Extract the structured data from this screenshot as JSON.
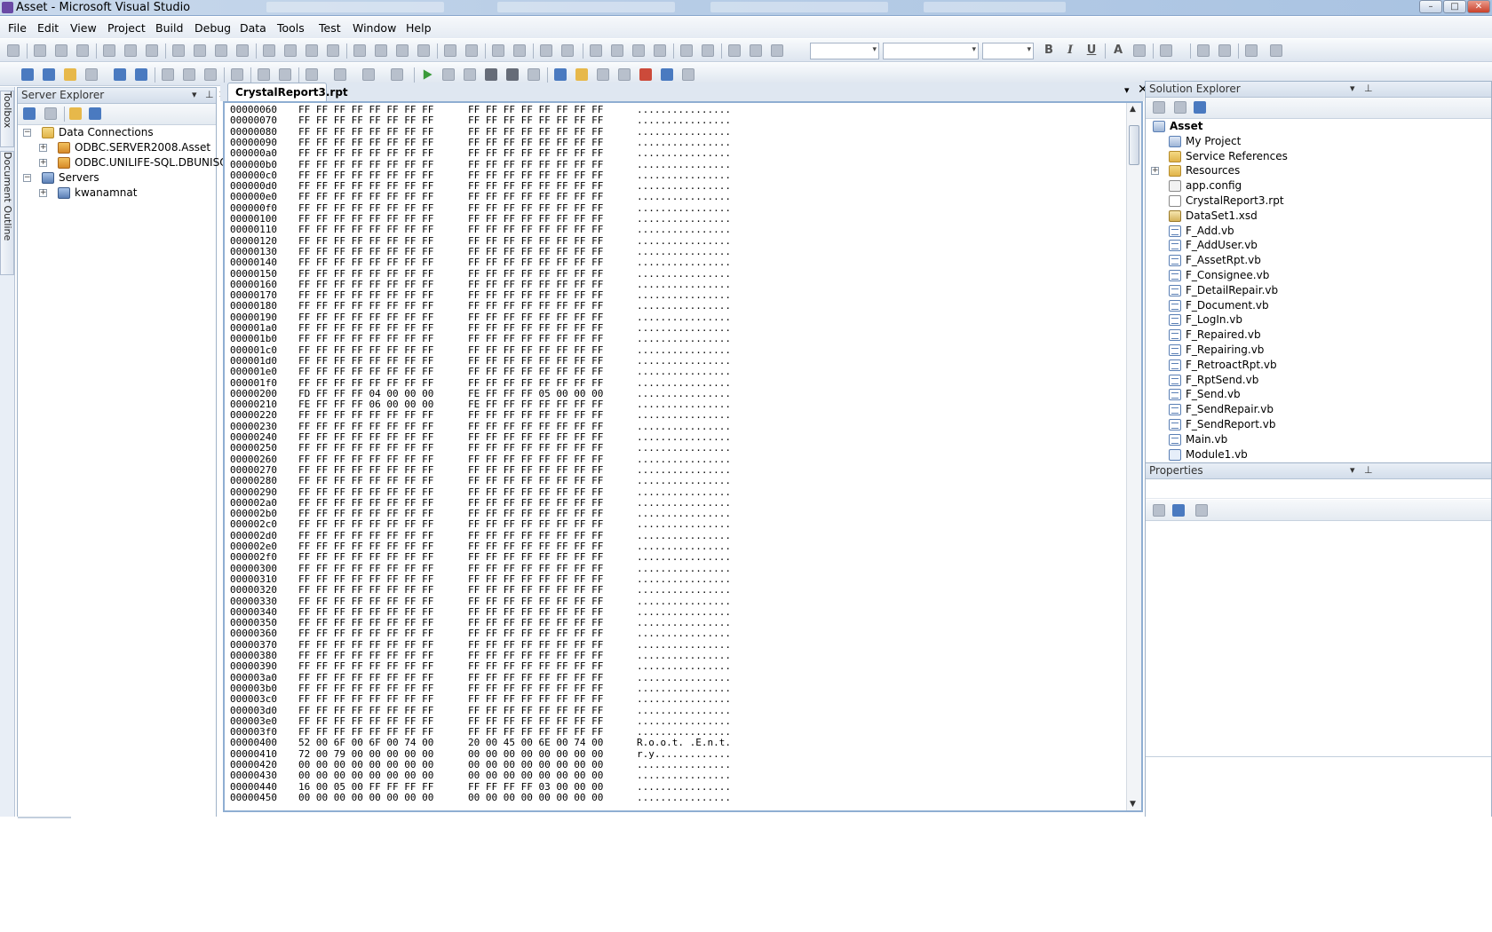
{
  "window": {
    "title": "Asset - Microsoft Visual Studio",
    "min_label": "–",
    "max_label": "□",
    "close_label": "✕"
  },
  "menu": [
    "File",
    "Edit",
    "View",
    "Project",
    "Build",
    "Debug",
    "Data",
    "Tools",
    "Test",
    "Window",
    "Help"
  ],
  "toolbar_text": {
    "bold": "B",
    "italic": "I",
    "underline": "U",
    "font_color": "A"
  },
  "left_tabs": {
    "toolbox": "Toolbox",
    "document_outline": "Document Outline"
  },
  "server_explorer": {
    "title": "Server Explorer",
    "pin": "▾",
    "autohide": "⊥",
    "close": "✕",
    "nodes": [
      {
        "label": "Data Connections",
        "expander": "−"
      },
      {
        "label": "ODBC.SERVER2008.Asset",
        "expander": "+"
      },
      {
        "label": "ODBC.UNILIFE-SQL.DBUNISOFT",
        "expander": "+"
      },
      {
        "label": "Servers",
        "expander": "−"
      },
      {
        "label": "kwanamnat",
        "expander": "+"
      }
    ]
  },
  "document": {
    "tab_label": "CrystalReport3.rpt",
    "dropdown": "▾",
    "close": "✕",
    "hex_rows": [
      {
        "addr": "00000060",
        "b1": "FF FF FF FF FF FF FF FF",
        "b2": "FF FF FF FF FF FF FF FF",
        "ascii": "................"
      },
      {
        "addr": "00000070",
        "b1": "FF FF FF FF FF FF FF FF",
        "b2": "FF FF FF FF FF FF FF FF",
        "ascii": "................"
      },
      {
        "addr": "00000080",
        "b1": "FF FF FF FF FF FF FF FF",
        "b2": "FF FF FF FF FF FF FF FF",
        "ascii": "................"
      },
      {
        "addr": "00000090",
        "b1": "FF FF FF FF FF FF FF FF",
        "b2": "FF FF FF FF FF FF FF FF",
        "ascii": "................"
      },
      {
        "addr": "000000a0",
        "b1": "FF FF FF FF FF FF FF FF",
        "b2": "FF FF FF FF FF FF FF FF",
        "ascii": "................"
      },
      {
        "addr": "000000b0",
        "b1": "FF FF FF FF FF FF FF FF",
        "b2": "FF FF FF FF FF FF FF FF",
        "ascii": "................"
      },
      {
        "addr": "000000c0",
        "b1": "FF FF FF FF FF FF FF FF",
        "b2": "FF FF FF FF FF FF FF FF",
        "ascii": "................"
      },
      {
        "addr": "000000d0",
        "b1": "FF FF FF FF FF FF FF FF",
        "b2": "FF FF FF FF FF FF FF FF",
        "ascii": "................"
      },
      {
        "addr": "000000e0",
        "b1": "FF FF FF FF FF FF FF FF",
        "b2": "FF FF FF FF FF FF FF FF",
        "ascii": "................"
      },
      {
        "addr": "000000f0",
        "b1": "FF FF FF FF FF FF FF FF",
        "b2": "FF FF FF FF FF FF FF FF",
        "ascii": "................"
      },
      {
        "addr": "00000100",
        "b1": "FF FF FF FF FF FF FF FF",
        "b2": "FF FF FF FF FF FF FF FF",
        "ascii": "................"
      },
      {
        "addr": "00000110",
        "b1": "FF FF FF FF FF FF FF FF",
        "b2": "FF FF FF FF FF FF FF FF",
        "ascii": "................"
      },
      {
        "addr": "00000120",
        "b1": "FF FF FF FF FF FF FF FF",
        "b2": "FF FF FF FF FF FF FF FF",
        "ascii": "................"
      },
      {
        "addr": "00000130",
        "b1": "FF FF FF FF FF FF FF FF",
        "b2": "FF FF FF FF FF FF FF FF",
        "ascii": "................"
      },
      {
        "addr": "00000140",
        "b1": "FF FF FF FF FF FF FF FF",
        "b2": "FF FF FF FF FF FF FF FF",
        "ascii": "................"
      },
      {
        "addr": "00000150",
        "b1": "FF FF FF FF FF FF FF FF",
        "b2": "FF FF FF FF FF FF FF FF",
        "ascii": "................"
      },
      {
        "addr": "00000160",
        "b1": "FF FF FF FF FF FF FF FF",
        "b2": "FF FF FF FF FF FF FF FF",
        "ascii": "................"
      },
      {
        "addr": "00000170",
        "b1": "FF FF FF FF FF FF FF FF",
        "b2": "FF FF FF FF FF FF FF FF",
        "ascii": "................"
      },
      {
        "addr": "00000180",
        "b1": "FF FF FF FF FF FF FF FF",
        "b2": "FF FF FF FF FF FF FF FF",
        "ascii": "................"
      },
      {
        "addr": "00000190",
        "b1": "FF FF FF FF FF FF FF FF",
        "b2": "FF FF FF FF FF FF FF FF",
        "ascii": "................"
      },
      {
        "addr": "000001a0",
        "b1": "FF FF FF FF FF FF FF FF",
        "b2": "FF FF FF FF FF FF FF FF",
        "ascii": "................"
      },
      {
        "addr": "000001b0",
        "b1": "FF FF FF FF FF FF FF FF",
        "b2": "FF FF FF FF FF FF FF FF",
        "ascii": "................"
      },
      {
        "addr": "000001c0",
        "b1": "FF FF FF FF FF FF FF FF",
        "b2": "FF FF FF FF FF FF FF FF",
        "ascii": "................"
      },
      {
        "addr": "000001d0",
        "b1": "FF FF FF FF FF FF FF FF",
        "b2": "FF FF FF FF FF FF FF FF",
        "ascii": "................"
      },
      {
        "addr": "000001e0",
        "b1": "FF FF FF FF FF FF FF FF",
        "b2": "FF FF FF FF FF FF FF FF",
        "ascii": "................"
      },
      {
        "addr": "000001f0",
        "b1": "FF FF FF FF FF FF FF FF",
        "b2": "FF FF FF FF FF FF FF FF",
        "ascii": "................"
      },
      {
        "addr": "00000200",
        "b1": "FD FF FF FF 04 00 00 00",
        "b2": "FE FF FF FF 05 00 00 00",
        "ascii": "................"
      },
      {
        "addr": "00000210",
        "b1": "FE FF FF FF 06 00 00 00",
        "b2": "FE FF FF FF FF FF FF FF",
        "ascii": "................"
      },
      {
        "addr": "00000220",
        "b1": "FF FF FF FF FF FF FF FF",
        "b2": "FF FF FF FF FF FF FF FF",
        "ascii": "................"
      },
      {
        "addr": "00000230",
        "b1": "FF FF FF FF FF FF FF FF",
        "b2": "FF FF FF FF FF FF FF FF",
        "ascii": "................"
      },
      {
        "addr": "00000240",
        "b1": "FF FF FF FF FF FF FF FF",
        "b2": "FF FF FF FF FF FF FF FF",
        "ascii": "................"
      },
      {
        "addr": "00000250",
        "b1": "FF FF FF FF FF FF FF FF",
        "b2": "FF FF FF FF FF FF FF FF",
        "ascii": "................"
      },
      {
        "addr": "00000260",
        "b1": "FF FF FF FF FF FF FF FF",
        "b2": "FF FF FF FF FF FF FF FF",
        "ascii": "................"
      },
      {
        "addr": "00000270",
        "b1": "FF FF FF FF FF FF FF FF",
        "b2": "FF FF FF FF FF FF FF FF",
        "ascii": "................"
      },
      {
        "addr": "00000280",
        "b1": "FF FF FF FF FF FF FF FF",
        "b2": "FF FF FF FF FF FF FF FF",
        "ascii": "................"
      },
      {
        "addr": "00000290",
        "b1": "FF FF FF FF FF FF FF FF",
        "b2": "FF FF FF FF FF FF FF FF",
        "ascii": "................"
      },
      {
        "addr": "000002a0",
        "b1": "FF FF FF FF FF FF FF FF",
        "b2": "FF FF FF FF FF FF FF FF",
        "ascii": "................"
      },
      {
        "addr": "000002b0",
        "b1": "FF FF FF FF FF FF FF FF",
        "b2": "FF FF FF FF FF FF FF FF",
        "ascii": "................"
      },
      {
        "addr": "000002c0",
        "b1": "FF FF FF FF FF FF FF FF",
        "b2": "FF FF FF FF FF FF FF FF",
        "ascii": "................"
      },
      {
        "addr": "000002d0",
        "b1": "FF FF FF FF FF FF FF FF",
        "b2": "FF FF FF FF FF FF FF FF",
        "ascii": "................"
      },
      {
        "addr": "000002e0",
        "b1": "FF FF FF FF FF FF FF FF",
        "b2": "FF FF FF FF FF FF FF FF",
        "ascii": "................"
      },
      {
        "addr": "000002f0",
        "b1": "FF FF FF FF FF FF FF FF",
        "b2": "FF FF FF FF FF FF FF FF",
        "ascii": "................"
      },
      {
        "addr": "00000300",
        "b1": "FF FF FF FF FF FF FF FF",
        "b2": "FF FF FF FF FF FF FF FF",
        "ascii": "................"
      },
      {
        "addr": "00000310",
        "b1": "FF FF FF FF FF FF FF FF",
        "b2": "FF FF FF FF FF FF FF FF",
        "ascii": "................"
      },
      {
        "addr": "00000320",
        "b1": "FF FF FF FF FF FF FF FF",
        "b2": "FF FF FF FF FF FF FF FF",
        "ascii": "................"
      },
      {
        "addr": "00000330",
        "b1": "FF FF FF FF FF FF FF FF",
        "b2": "FF FF FF FF FF FF FF FF",
        "ascii": "................"
      },
      {
        "addr": "00000340",
        "b1": "FF FF FF FF FF FF FF FF",
        "b2": "FF FF FF FF FF FF FF FF",
        "ascii": "................"
      },
      {
        "addr": "00000350",
        "b1": "FF FF FF FF FF FF FF FF",
        "b2": "FF FF FF FF FF FF FF FF",
        "ascii": "................"
      },
      {
        "addr": "00000360",
        "b1": "FF FF FF FF FF FF FF FF",
        "b2": "FF FF FF FF FF FF FF FF",
        "ascii": "................"
      },
      {
        "addr": "00000370",
        "b1": "FF FF FF FF FF FF FF FF",
        "b2": "FF FF FF FF FF FF FF FF",
        "ascii": "................"
      },
      {
        "addr": "00000380",
        "b1": "FF FF FF FF FF FF FF FF",
        "b2": "FF FF FF FF FF FF FF FF",
        "ascii": "................"
      },
      {
        "addr": "00000390",
        "b1": "FF FF FF FF FF FF FF FF",
        "b2": "FF FF FF FF FF FF FF FF",
        "ascii": "................"
      },
      {
        "addr": "000003a0",
        "b1": "FF FF FF FF FF FF FF FF",
        "b2": "FF FF FF FF FF FF FF FF",
        "ascii": "................"
      },
      {
        "addr": "000003b0",
        "b1": "FF FF FF FF FF FF FF FF",
        "b2": "FF FF FF FF FF FF FF FF",
        "ascii": "................"
      },
      {
        "addr": "000003c0",
        "b1": "FF FF FF FF FF FF FF FF",
        "b2": "FF FF FF FF FF FF FF FF",
        "ascii": "................"
      },
      {
        "addr": "000003d0",
        "b1": "FF FF FF FF FF FF FF FF",
        "b2": "FF FF FF FF FF FF FF FF",
        "ascii": "................"
      },
      {
        "addr": "000003e0",
        "b1": "FF FF FF FF FF FF FF FF",
        "b2": "FF FF FF FF FF FF FF FF",
        "ascii": "................"
      },
      {
        "addr": "000003f0",
        "b1": "FF FF FF FF FF FF FF FF",
        "b2": "FF FF FF FF FF FF FF FF",
        "ascii": "................"
      },
      {
        "addr": "00000400",
        "b1": "52 00 6F 00 6F 00 74 00",
        "b2": "20 00 45 00 6E 00 74 00",
        "ascii": "R.o.o.t. .E.n.t."
      },
      {
        "addr": "00000410",
        "b1": "72 00 79 00 00 00 00 00",
        "b2": "00 00 00 00 00 00 00 00",
        "ascii": "r.y............."
      },
      {
        "addr": "00000420",
        "b1": "00 00 00 00 00 00 00 00",
        "b2": "00 00 00 00 00 00 00 00",
        "ascii": "................"
      },
      {
        "addr": "00000430",
        "b1": "00 00 00 00 00 00 00 00",
        "b2": "00 00 00 00 00 00 00 00",
        "ascii": "................"
      },
      {
        "addr": "00000440",
        "b1": "16 00 05 00 FF FF FF FF",
        "b2": "FF FF FF FF 03 00 00 00",
        "ascii": "................"
      },
      {
        "addr": "00000450",
        "b1": "00 00 00 00 00 00 00 00",
        "b2": "00 00 00 00 00 00 00 00",
        "ascii": "................"
      }
    ]
  },
  "solution_explorer": {
    "title": "Solution Explorer",
    "pin": "▾",
    "autohide": "⊥",
    "items": [
      {
        "label": "Asset",
        "icon": "project-icon",
        "bold": true
      },
      {
        "label": "My Project",
        "icon": "my-project-icon"
      },
      {
        "label": "Service References",
        "icon": "folder-icon"
      },
      {
        "label": "Resources",
        "icon": "folder-icon",
        "expander": "+"
      },
      {
        "label": "app.config",
        "icon": "config-file-icon"
      },
      {
        "label": "CrystalReport3.rpt",
        "icon": "report-file-icon"
      },
      {
        "label": "DataSet1.xsd",
        "icon": "dataset-icon"
      },
      {
        "label": "F_Add.vb",
        "icon": "form-icon"
      },
      {
        "label": "F_AddUser.vb",
        "icon": "form-icon"
      },
      {
        "label": "F_AssetRpt.vb",
        "icon": "form-icon"
      },
      {
        "label": "F_Consignee.vb",
        "icon": "form-icon"
      },
      {
        "label": "F_DetailRepair.vb",
        "icon": "form-icon"
      },
      {
        "label": "F_Document.vb",
        "icon": "form-icon"
      },
      {
        "label": "F_LogIn.vb",
        "icon": "form-icon"
      },
      {
        "label": "F_Repaired.vb",
        "icon": "form-icon"
      },
      {
        "label": "F_Repairing.vb",
        "icon": "form-icon"
      },
      {
        "label": "F_RetroactRpt.vb",
        "icon": "form-icon"
      },
      {
        "label": "F_RptSend.vb",
        "icon": "form-icon"
      },
      {
        "label": "F_Send.vb",
        "icon": "form-icon"
      },
      {
        "label": "F_SendRepair.vb",
        "icon": "form-icon"
      },
      {
        "label": "F_SendReport.vb",
        "icon": "form-icon"
      },
      {
        "label": "Main.vb",
        "icon": "form-icon"
      },
      {
        "label": "Module1.vb",
        "icon": "module-icon"
      }
    ]
  },
  "properties": {
    "title": "Properties",
    "pin": "▾",
    "autohide": "⊥"
  }
}
